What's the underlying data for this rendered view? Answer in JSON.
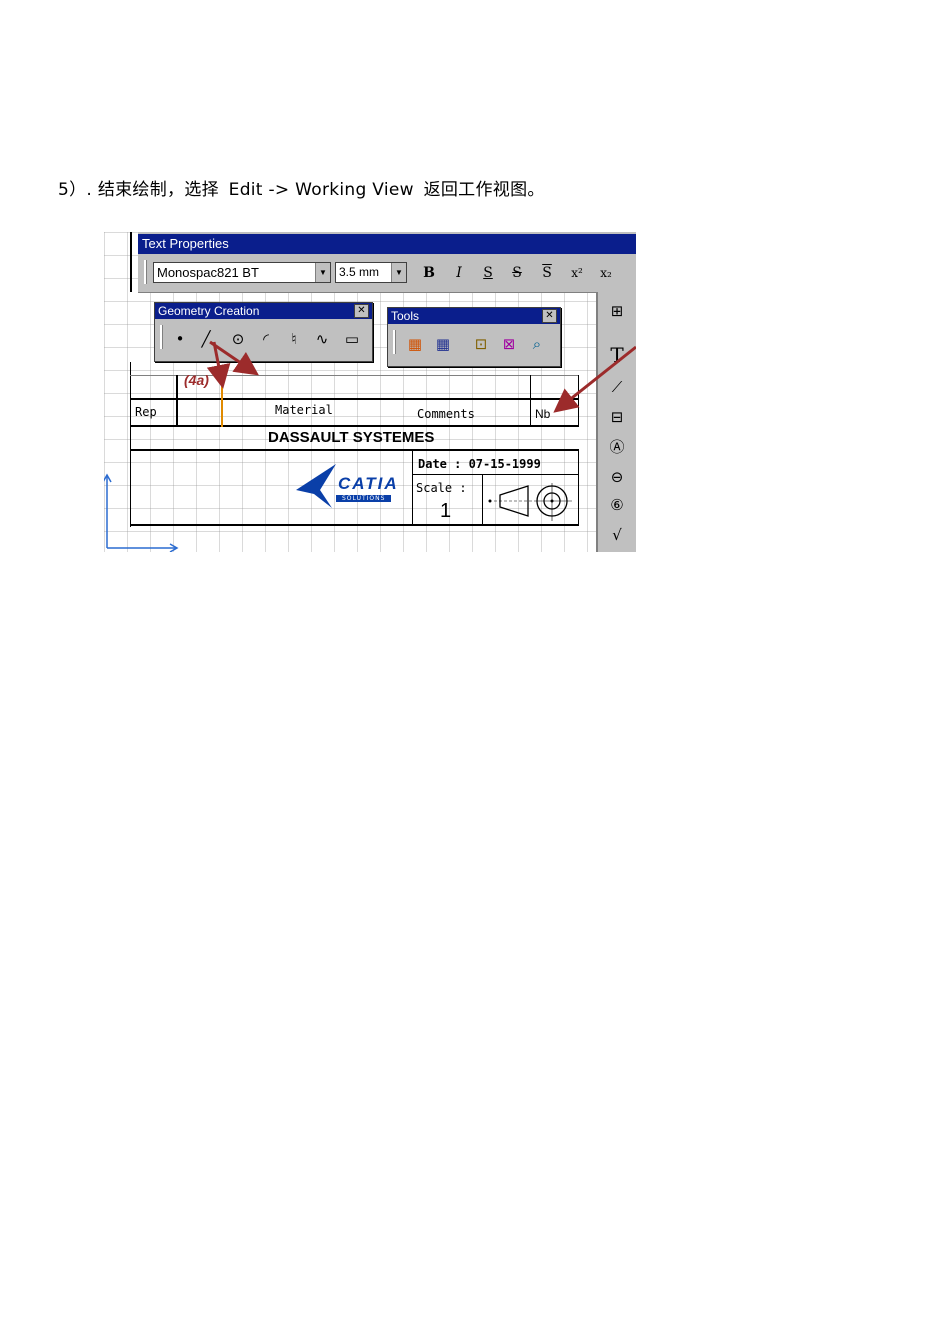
{
  "instruction": {
    "prefix": "5）. 结束绘制，选择",
    "menu_path": "Edit -> Working View",
    "suffix": "返回工作视图。"
  },
  "text_properties": {
    "title": "Text Properties",
    "font": "Monospac821 BT",
    "size": "3.5 mm",
    "buttons": [
      "B",
      "I",
      "S",
      "S",
      "S",
      "x²",
      "x₂"
    ]
  },
  "geometry_creation": {
    "title": "Geometry Creation"
  },
  "tools": {
    "title": "Tools"
  },
  "annotation": {
    "label": "(4a)",
    "color": "#9c2b2b"
  },
  "title_block": {
    "rep": "Rep",
    "material": "Material",
    "comments": "Comments",
    "nb": "Nb",
    "company": "DASSAULT SYSTEMES",
    "date_label": "Date : 07-15-1999",
    "scale_label": "Scale :",
    "scale_value": "1",
    "logo_text": "CATIA",
    "logo_sub": "SOLUTIONS"
  },
  "colors": {
    "title_bar": "#0a1e8c",
    "toolbar_bg": "#c0c0c0",
    "logo_blue": "#0a3fa8"
  }
}
